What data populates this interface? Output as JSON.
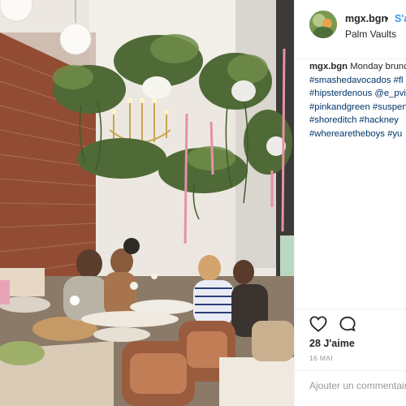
{
  "post": {
    "username": "mgx.bgn",
    "separator": "•",
    "follow_label": "S'abonner",
    "location": "Palm Vaults",
    "caption": {
      "user": "mgx.bgn",
      "text_start": "Monday brunch",
      "lines": [
        "#smashedavocados #fl",
        "#hipsterdenous @e_pvi",
        "#pinkandgreen #suspen",
        "#shoreditch #hackney",
        "#wherearetheboys #yu"
      ]
    },
    "likes": "28 J'aime",
    "date": "16 MAI",
    "comment_placeholder": "Ajouter un commentaire..."
  },
  "icons": {
    "like": "heart-icon",
    "comment": "comment-icon",
    "avatar": "avatar"
  },
  "colors": {
    "link_blue": "#3897f0",
    "hashtag": "#003569",
    "text": "#262626",
    "muted": "#999999",
    "divider": "#efefef"
  }
}
